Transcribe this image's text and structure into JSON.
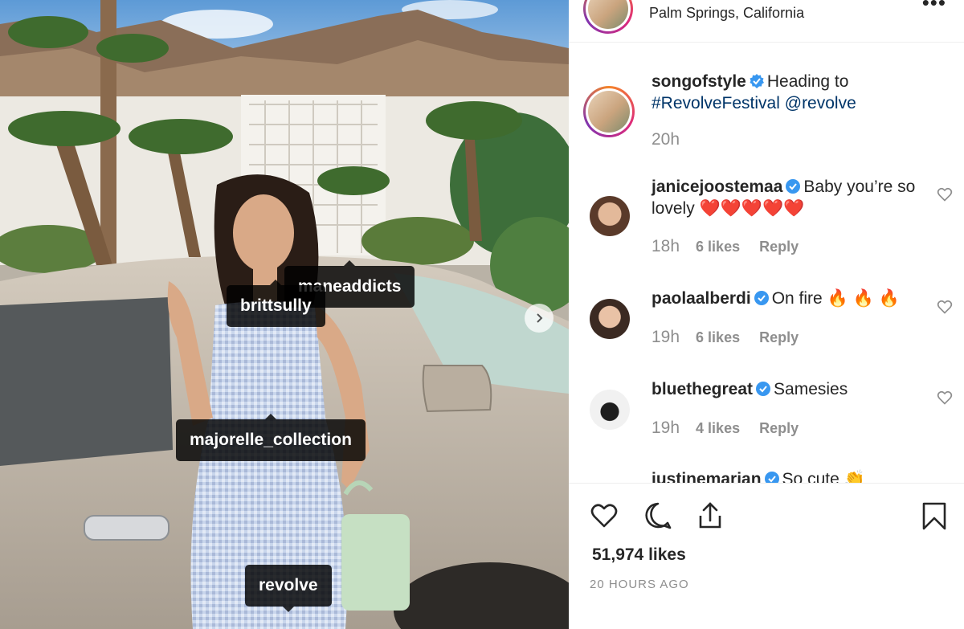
{
  "post": {
    "location": "Palm Springs, California",
    "more_icon": "more-icon",
    "caption": {
      "username": "songofstyle",
      "text_before": "Heading to",
      "hashtag": "#RevolveFestival",
      "mention": "@revolve",
      "time": "20h"
    },
    "likes": "51,974 likes",
    "time_ago": "20 HOURS AGO"
  },
  "photo_tags": [
    {
      "label": "maneaddicts"
    },
    {
      "label": "brittsully"
    },
    {
      "label": "majorelle_collection"
    },
    {
      "label": "revolve"
    }
  ],
  "comments": [
    {
      "username": "janicejoostemaa",
      "text": "Baby you’re so lovely",
      "emoji": "❤️❤️❤️❤️❤️",
      "time": "18h",
      "likes": "6 likes",
      "reply": "Reply"
    },
    {
      "username": "paolaalberdi",
      "text": "On fire",
      "emoji": "🔥 🔥 🔥",
      "time": "19h",
      "likes": "6 likes",
      "reply": "Reply"
    },
    {
      "username": "bluethegreat",
      "text": "Samesies",
      "emoji": "",
      "time": "19h",
      "likes": "4 likes",
      "reply": "Reply"
    },
    {
      "username": "justinemarian",
      "text": "So cute",
      "emoji": "👏",
      "time": "",
      "likes": "",
      "reply": ""
    }
  ],
  "icons": [
    "heart-icon",
    "comment-icon",
    "share-icon",
    "bookmark-icon",
    "verified-badge-icon",
    "chevron-right-icon"
  ],
  "colors": {
    "link": "#003569",
    "verified": "#3897f0",
    "muted": "#8e8e8e",
    "text": "#262626"
  }
}
